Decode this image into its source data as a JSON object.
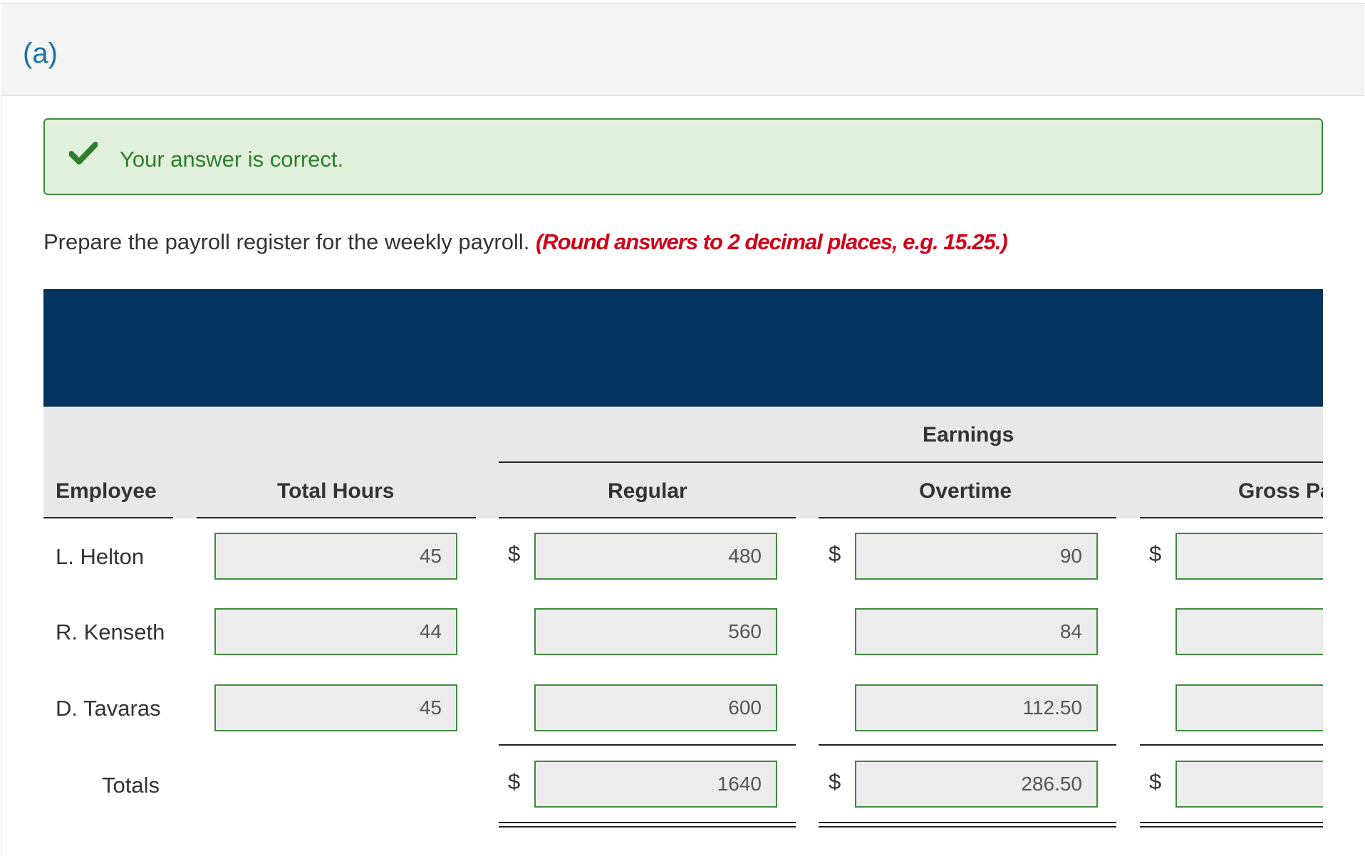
{
  "part": {
    "label": "(a)"
  },
  "feedback": {
    "message": "Your answer is correct.",
    "icon": "checkmark-icon",
    "color": "#3f8a3f"
  },
  "prompt": {
    "text": "Prepare the payroll register for the weekly payroll.",
    "note": "(Round answers to 2 decimal places, e.g. 15.25.)"
  },
  "table": {
    "group_header": "Earnings",
    "columns": {
      "employee": "Employee",
      "total_hours": "Total Hours",
      "regular": "Regular",
      "overtime": "Overtime",
      "gross_pay": "Gross Pa"
    },
    "currency_symbol": "$",
    "rows": [
      {
        "employee": "L. Helton",
        "total_hours": "45",
        "regular": "480",
        "overtime": "90",
        "gross_pay": ""
      },
      {
        "employee": "R. Kenseth",
        "total_hours": "44",
        "regular": "560",
        "overtime": "84",
        "gross_pay": ""
      },
      {
        "employee": "D. Tavaras",
        "total_hours": "45",
        "regular": "600",
        "overtime": "112.50",
        "gross_pay": ""
      }
    ],
    "totals": {
      "label": "Totals",
      "regular": "1640",
      "overtime": "286.50",
      "gross_pay": ""
    }
  },
  "colors": {
    "header_band": "#03345f",
    "correct_border": "#3f8a3f",
    "note_red": "#d0021b",
    "part_label": "#1b6fa6"
  }
}
